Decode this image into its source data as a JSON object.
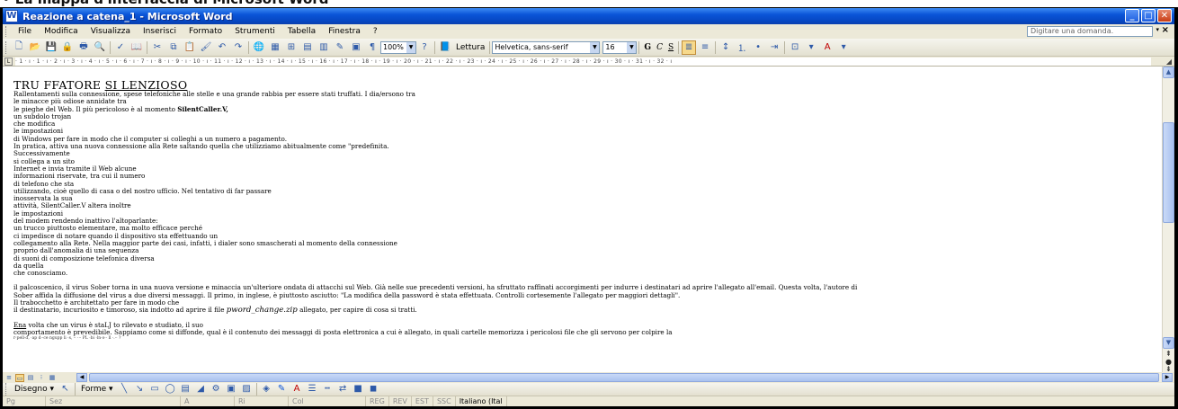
{
  "heading": "• La mappa d'interfaccia di Microsoft Word",
  "window": {
    "title": "Reazione a catena_1 - Microsoft Word"
  },
  "window_controls": {
    "minimize": "_",
    "maximize": "□",
    "close": "✕"
  },
  "menu": {
    "items": [
      "File",
      "Modifica",
      "Visualizza",
      "Inserisci",
      "Formato",
      "Strumenti",
      "Tabella",
      "Finestra",
      "?"
    ],
    "ask_placeholder": "Digitare una domanda.",
    "close_glyph": "×"
  },
  "toolbar": {
    "zoom": "100%",
    "reading": "Lettura",
    "font": "Helvetica, sans-serif",
    "font_size": "16",
    "bold": "G",
    "italic": "C",
    "underline": "S"
  },
  "ruler": {
    "text": "· 1 · ı · 1 · ı · 2 · ı · 3 · ı · 4 · ı · 5 · ı · 6 · ı · 7 · ı · 8 · ı · 9 · ı · 10 · ı · 11 · ı · 12 · ı · 13 · ı · 14 · ı · 15 · ı · 16 · ı · 17 · ı · 18 · ı · 19 · ı · 20 · ı · 21 · ı · 22 · ı · 23 · ı · 24 · ı · 25 · ı · 26 · ı · 27 · ı · 28 · ı · 29 · ı · 30 · ı · 31 · ı · 32 · ı"
  },
  "document": {
    "title_part1": "TRU FFATORE ",
    "title_part2": "SI LENZIOSO",
    "p1_before": "Rallentamenti sulla connessione, spese telefoniche alle stelle e una grande rabbia per essere stati truffati. I dia/ersono tra",
    "line1": "le minacce più odiose annidate tra",
    "line2_before": "le pieghe del Web. Il più pericoloso è al momento ",
    "line2_bold": "SilentCaller.V,",
    "lines": [
      "un subdolo trojan",
      "che modifica",
      "le impostazioni",
      "di Windows per fare in modo che il computer si colleghi a un numero a pagamento.",
      "In pratica, attiva una nuova connessione alla Rete saltando quella che utilizziamo abitualmente come \"predefinita.",
      "Successivamente",
      "si collega a un sito",
      "Internet e invia tramite il Web alcune",
      "informazioni riservate, tra cui il numero",
      "di telefono che sta",
      "utilizzando, cioè quello di casa o del nostro ufficio. Nel tentativo di far passare",
      "inosservata la sua",
      "attività, SilentCaller.V altera inoltre",
      "le impostazioni",
      "del modem rendendo inattivo l'altoparlante:",
      "un trucco piuttosto elementare, ma molto efficace perché",
      "ci impedisce di notare quando il dispositivo sta effettuando un",
      "collegamento alla Rete. Nella maggior parte dei casi, infatti, i dialer sono smascherati al momento della connessione",
      "proprio dall'anomalia di una sequenza",
      "di suoni di composizione telefonica diversa",
      "da quella",
      "che conosciamo."
    ],
    "p2_line1": "il palcoscenico, il virus Sober torna in una nuova versione e minaccia un'ulteriore ondata di attacchi sul Web. Già nelle sue precedenti versioni, ha sfruttato raffinati accorgimenti per indurre i destinatari ad aprire l'allegato all'email. Questa volta, l'autore di",
    "p2_line2": "Sober affida la diffusione del virus a due diversi messaggi. Il primo, in inglese, è piuttosto asciutto: \"La modifica della password è stata effettuata. Controlli cortesemente l'allegato per maggiori dettagli\".",
    "p2_line3": "Il trabocchetto è architettato per fare in modo che",
    "p2_line4_before": "il destinatario, incuriosito e timoroso, sia indotto ad aprire il file ",
    "p2_line4_file": "pword_change.zip",
    "p2_line4_after": " allegato, per capire di cosa si tratti.",
    "p3_underlined": "Ena",
    "p3_line1_rest": " volta che un virus è staLJ to rilevato e studiato, il suo",
    "p3_line2": "comportamento è prevedibile. Sappiamo come si diffonde, qual è il contenuto dei messaggi di posta elettronica a cui è allegato, in quali cartelle memorizza i pericolosi file che gli servono per colpire la",
    "p3_line3": "r·pell·d, ·ap d··ce ngupp li ·s, ·· ··· PL ·bi ·ln·o·· ll ·.·· ?"
  },
  "drawbar": {
    "draw": "Disegno ▾",
    "shapes": "Forme ▾"
  },
  "statusbar": {
    "cells": [
      "Pg",
      "Sez",
      "A",
      "Ri",
      "Col",
      "REG",
      "REV",
      "EST",
      "SSC"
    ],
    "language": "Italiano (Ital"
  }
}
